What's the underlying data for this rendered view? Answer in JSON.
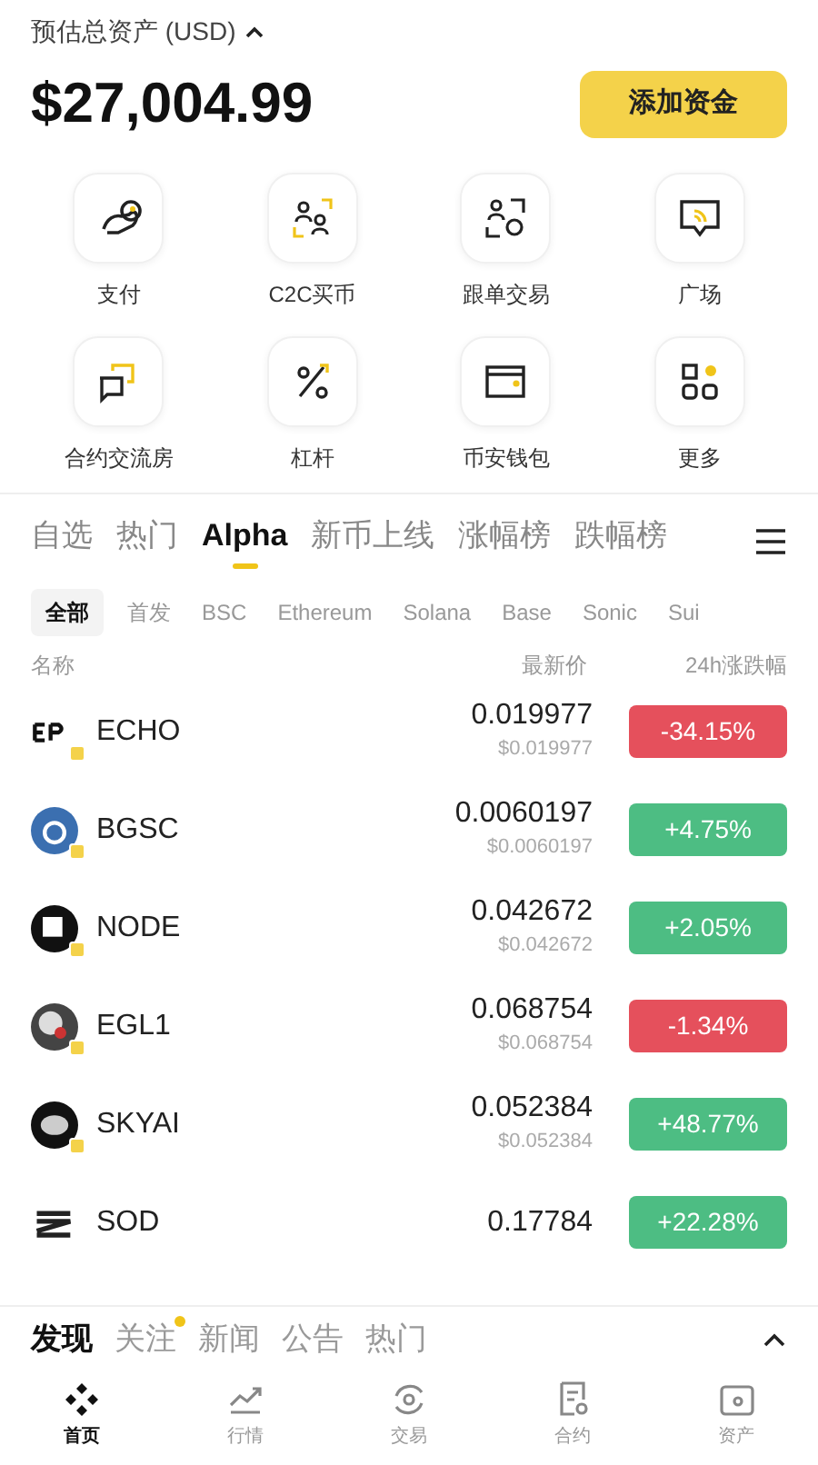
{
  "header": {
    "label": "预估总资产 (USD)",
    "total": "$27,004.99",
    "add_funds": "添加资金"
  },
  "shortcuts": [
    {
      "label": "支付"
    },
    {
      "label": "C2C买币"
    },
    {
      "label": "跟单交易"
    },
    {
      "label": "广场"
    },
    {
      "label": "合约交流房"
    },
    {
      "label": "杠杆"
    },
    {
      "label": "币安钱包"
    },
    {
      "label": "更多"
    }
  ],
  "market_tabs": [
    {
      "label": "自选",
      "selected": false
    },
    {
      "label": "热门",
      "selected": false
    },
    {
      "label": "Alpha",
      "selected": true
    },
    {
      "label": "新币上线",
      "selected": false
    },
    {
      "label": "涨幅榜",
      "selected": false
    },
    {
      "label": "跌幅榜",
      "selected": false
    }
  ],
  "chains": [
    {
      "label": "全部",
      "selected": true
    },
    {
      "label": "首发",
      "selected": false
    },
    {
      "label": "BSC",
      "selected": false
    },
    {
      "label": "Ethereum",
      "selected": false
    },
    {
      "label": "Solana",
      "selected": false
    },
    {
      "label": "Base",
      "selected": false
    },
    {
      "label": "Sonic",
      "selected": false
    },
    {
      "label": "Sui",
      "selected": false
    }
  ],
  "table": {
    "columns": [
      "名称",
      "最新价",
      "24h涨跌幅"
    ],
    "rows": [
      {
        "name": "ECHO",
        "price": "0.019977",
        "usd": "$0.019977",
        "change": "-34.15%",
        "color": "#e5505c"
      },
      {
        "name": "BGSC",
        "price": "0.0060197",
        "usd": "$0.0060197",
        "change": "+4.75%",
        "color": "#4dbd83"
      },
      {
        "name": "NODE",
        "price": "0.042672",
        "usd": "$0.042672",
        "change": "+2.05%",
        "color": "#4dbd83"
      },
      {
        "name": "EGL1",
        "price": "0.068754",
        "usd": "$0.068754",
        "change": "-1.34%",
        "color": "#e5505c"
      },
      {
        "name": "SKYAI",
        "price": "0.052384",
        "usd": "$0.052384",
        "change": "+48.77%",
        "color": "#4dbd83"
      },
      {
        "name": "SOD",
        "price": "0.17784",
        "change": "+22.28%",
        "color": "#4dbd83"
      }
    ]
  },
  "feed_tabs": [
    {
      "label": "发现",
      "selected": true,
      "dot": false
    },
    {
      "label": "关注",
      "selected": false,
      "dot": true
    },
    {
      "label": "新闻",
      "selected": false,
      "dot": false
    },
    {
      "label": "公告",
      "selected": false,
      "dot": false
    },
    {
      "label": "热门",
      "selected": false,
      "dot": false
    }
  ],
  "nav": [
    {
      "label": "首页",
      "selected": true
    },
    {
      "label": "行情",
      "selected": false
    },
    {
      "label": "交易",
      "selected": false
    },
    {
      "label": "合约",
      "selected": false
    },
    {
      "label": "资产",
      "selected": false
    }
  ]
}
